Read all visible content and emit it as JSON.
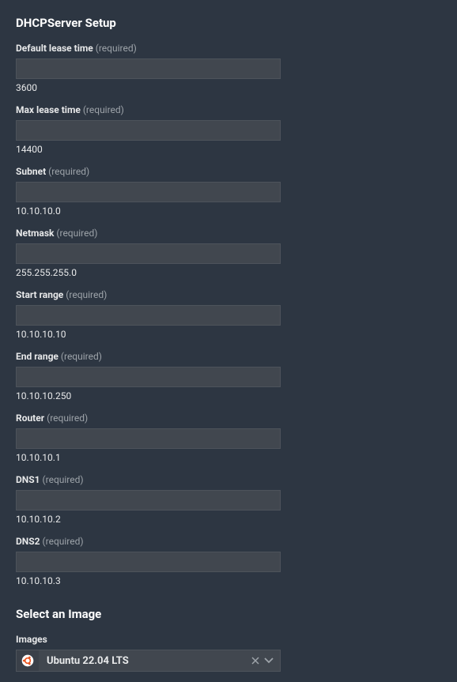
{
  "section1_title": "DHCPServer Setup",
  "section2_title": "Select an Image",
  "required_label": " (required)",
  "fields": {
    "default_lease": {
      "label": "Default lease time",
      "helper": "3600"
    },
    "max_lease": {
      "label": "Max lease time",
      "helper": "14400"
    },
    "subnet": {
      "label": "Subnet",
      "helper": "10.10.10.0"
    },
    "netmask": {
      "label": "Netmask",
      "helper": "255.255.255.0"
    },
    "start_range": {
      "label": "Start range",
      "helper": "10.10.10.10"
    },
    "end_range": {
      "label": "End range",
      "helper": "10.10.10.250"
    },
    "router": {
      "label": "Router",
      "helper": "10.10.10.1"
    },
    "dns1": {
      "label": "DNS1",
      "helper": "10.10.10.2"
    },
    "dns2": {
      "label": "DNS2",
      "helper": "10.10.10.3"
    }
  },
  "images": {
    "label": "Images",
    "selected": "Ubuntu 22.04 LTS"
  }
}
